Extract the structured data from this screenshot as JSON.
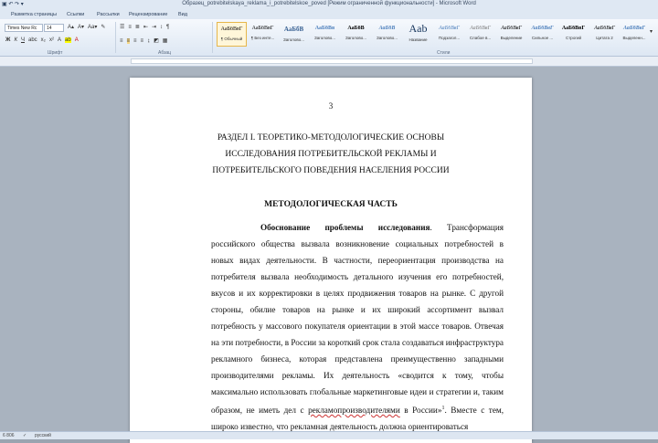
{
  "window": {
    "title": "Образец_potrebitelskaya_reklama_i_potrebitelskoe_poved [Режим ограниченной функциональности] - Microsoft Word"
  },
  "tabs": [
    "Разметка страницы",
    "Ссылки",
    "Рассылки",
    "Рецензирование",
    "Вид"
  ],
  "ribbon": {
    "font_name": "Times New Rc",
    "font_size": "14",
    "group_font": "Шрифт",
    "group_paragraph": "Абзац",
    "group_styles": "Стили",
    "styles": [
      {
        "preview": "АаБбВвГ",
        "label": "¶ Обычный"
      },
      {
        "preview": "АаБбВвГ",
        "label": "¶ Без инте..."
      },
      {
        "preview": "АаБбВ",
        "label": "Заголово..."
      },
      {
        "preview": "АаБбВв",
        "label": "Заголово..."
      },
      {
        "preview": "АаБбВ",
        "label": "Заголово..."
      },
      {
        "preview": "АаБбВ",
        "label": "Заголово..."
      },
      {
        "preview": "Aab",
        "label": "Название"
      },
      {
        "preview": "АаБбВвГ",
        "label": "Подзагол..."
      },
      {
        "preview": "АаБбВвГ",
        "label": "Слабое в..."
      },
      {
        "preview": "АаБбВвГ",
        "label": "Выделение"
      },
      {
        "preview": "АаБбВвГ",
        "label": "Сильное ..."
      },
      {
        "preview": "АаБбВвГ",
        "label": "Строгий"
      },
      {
        "preview": "АаБбВвГ",
        "label": "Цитата 2"
      },
      {
        "preview": "АаБбВвГ",
        "label": "Выделенн..."
      }
    ]
  },
  "document": {
    "page_number": "3",
    "heading_lines": [
      "РАЗДЕЛ I. ТЕОРЕТИКО-МЕТОДОЛОГИЧЕСКИЕ  ОСНОВЫ",
      "ИССЛЕДОВАНИЯ ПОТРЕБИТЕЛЬСКОЙ РЕКЛАМЫ И",
      "ПОТРЕБИТЕЛЬСКОГО ПОВЕДЕНИЯ НАСЕЛЕНИЯ РОССИИ"
    ],
    "section_title": "МЕТОДОЛОГИЧЕСКАЯ ЧАСТЬ",
    "para_bold": "Обоснование проблемы исследования",
    "para_text_1": ". Трансформация российского общества вызвала возникновение социальных потребностей в новых видах деятельности. В частности, переориентация производства на потребителя вызвала необходимость детального изучения его потребностей, вкусов и их корректировки в целях продвижения товаров на рынке. С другой стороны, обилие товаров на рынке и их широкий ассортимент вызвал потребность у массового покупателя ориентации в этой массе товаров. Отвечая на эти потребности, в России за короткий срок стала создаваться инфраструктура рекламного бизнеса, которая представлена преимущественно западными производителями рекламы. Их деятельность «сводится к тому, чтобы максимально использовать глобальные маркетинговые идеи и стратегии и, таким образом, не иметь дел с ",
    "para_wavy": "рекламопроизводителями",
    "para_text_2": " в России»",
    "footnote": "1",
    "para_text_3": ". Вместе с тем, широко известно, что рекламная деятельность должна ориентироваться"
  },
  "statusbar": {
    "words": "6 806",
    "language": "русский"
  }
}
